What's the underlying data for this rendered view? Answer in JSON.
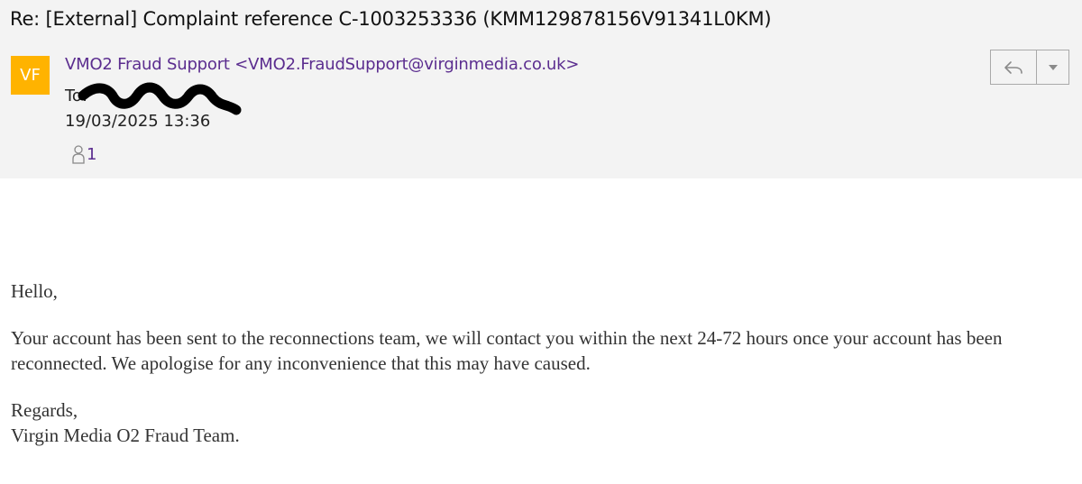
{
  "email": {
    "subject": "Re: [External] Complaint reference C-1003253336 (KMM129878156V91341L0KM)",
    "sender": {
      "initials": "VF",
      "display": "VMO2 Fraud Support <VMO2.FraudSupport@virginmedia.co.uk>"
    },
    "to_label": "To:",
    "to_value": "",
    "date": "19/03/2025 13:36",
    "recipients_count": "1",
    "body": {
      "greeting": "Hello,",
      "paragraph": "Your account has been sent to the reconnections team, we will contact you within the next 24-72 hours once your account has been reconnected. We apologise for any inconvenience that this may have caused.",
      "signoff": "Regards,",
      "signature": "Virgin Media O2 Fraud Team."
    }
  },
  "icons": {
    "reply": "reply-icon",
    "dropdown": "chevron-down-icon",
    "person": "person-icon"
  },
  "colors": {
    "header_bg": "#f3f3f3",
    "avatar_bg": "#ffb300",
    "link_purple": "#5b2d8f"
  }
}
